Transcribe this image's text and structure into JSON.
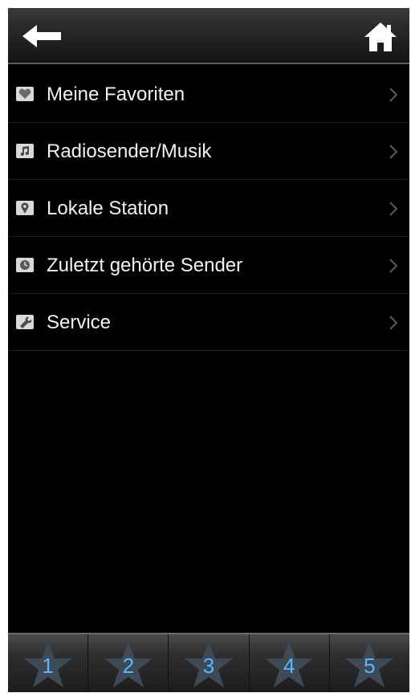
{
  "header": {
    "back_icon": "back-arrow-icon",
    "home_icon": "home-icon"
  },
  "menu": {
    "items": [
      {
        "label": "Meine Favoriten",
        "icon": "favorites-icon"
      },
      {
        "label": "Radiosender/Musik",
        "icon": "music-note-icon"
      },
      {
        "label": "Lokale Station",
        "icon": "location-pin-icon"
      },
      {
        "label": "Zuletzt gehörte Sender",
        "icon": "clock-icon"
      },
      {
        "label": "Service",
        "icon": "service-icon"
      }
    ]
  },
  "presets": [
    {
      "label": "1"
    },
    {
      "label": "2"
    },
    {
      "label": "3"
    },
    {
      "label": "4"
    },
    {
      "label": "5"
    }
  ],
  "colors": {
    "preset_number": "#58b8ff",
    "background": "#000000"
  }
}
